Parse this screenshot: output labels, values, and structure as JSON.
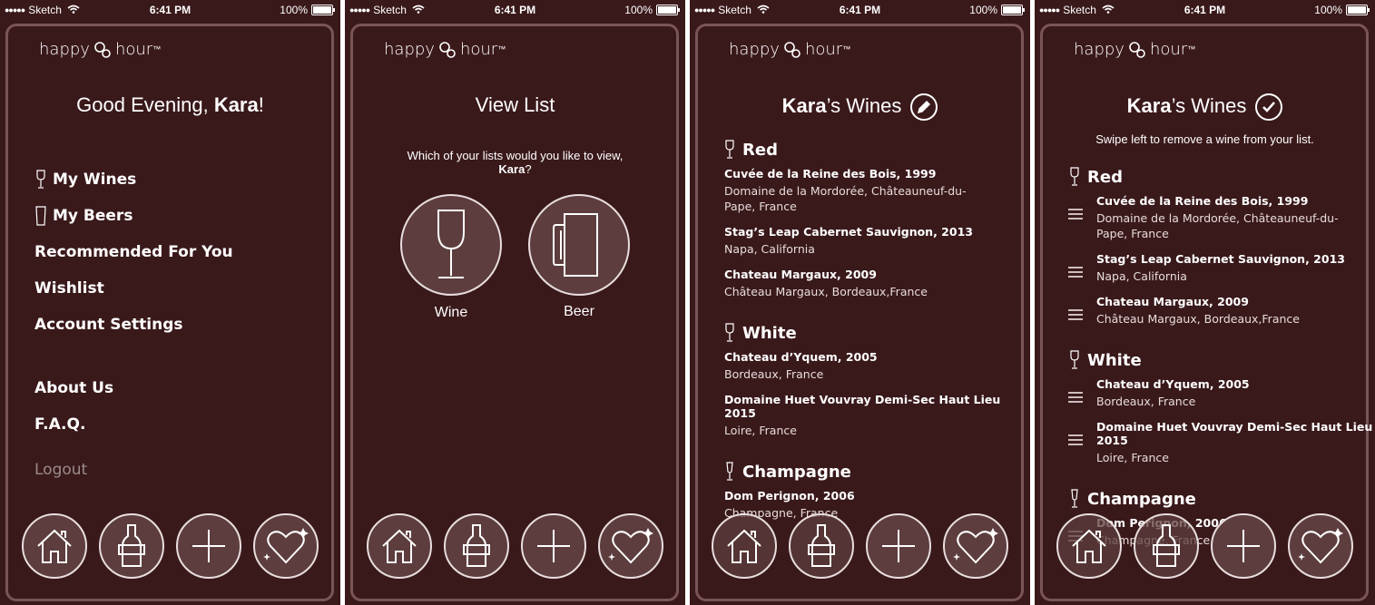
{
  "status": {
    "carrier": "Sketch",
    "time": "6:41 PM",
    "battery": "100%"
  },
  "logo": {
    "left": "happy",
    "right": "hour",
    "tm": "™"
  },
  "screen1": {
    "greeting_prefix": "Good Evening, ",
    "greeting_name": "Kara",
    "greeting_suffix": "!",
    "menu": [
      "My Wines",
      "My Beers",
      "Recommended For You",
      "Wishlist",
      "Account Settings"
    ],
    "menu2": [
      "About Us",
      "F.A.Q."
    ],
    "logout": "Logout"
  },
  "screen2": {
    "title": "View List",
    "prompt_line1": "Which of your lists would you like to view,",
    "prompt_name": "Kara",
    "prompt_suffix": "?",
    "wine_label": "Wine",
    "beer_label": "Beer"
  },
  "screen3": {
    "title_name": "Kara",
    "title_suffix": "’s Wines",
    "sections": [
      {
        "name": "Red",
        "wines": [
          {
            "name": "Cuvée de la Reine des Bois, 1999",
            "region": "Domaine de la Mordorée, Châteauneuf-du-Pape, France"
          },
          {
            "name": "Stag’s Leap Cabernet Sauvignon, 2013",
            "region": "Napa, California"
          },
          {
            "name": "Chateau Margaux, 2009",
            "region": "Château Margaux, Bordeaux,France"
          }
        ]
      },
      {
        "name": "White",
        "wines": [
          {
            "name": "Chateau d’Yquem, 2005",
            "region": "Bordeaux, France"
          },
          {
            "name": "Domaine Huet Vouvray Demi-Sec Haut Lieu 2015",
            "region": "Loire, France"
          }
        ]
      },
      {
        "name": "Champagne",
        "wines": [
          {
            "name": "Dom Perignon, 2006",
            "region": "Champagne, France"
          }
        ]
      }
    ]
  },
  "screen4": {
    "title_name": "Kara",
    "title_suffix": "’s Wines",
    "hint": "Swipe left to remove a wine from your list."
  },
  "icons": {
    "nav": [
      "home-icon",
      "bottle-icon",
      "plus-icon",
      "heart-sparkle-icon"
    ],
    "edit": "pencil-icon",
    "done": "checkmark-icon"
  }
}
